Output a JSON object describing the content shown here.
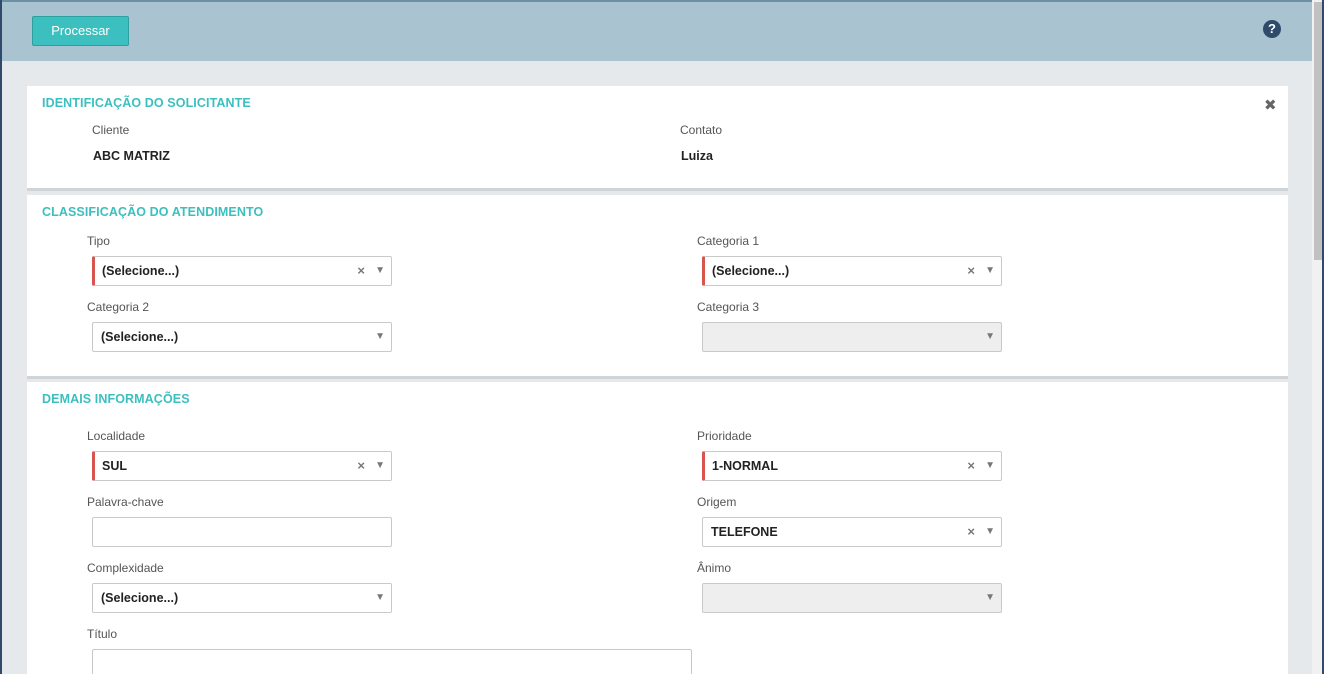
{
  "toolbar": {
    "processar_label": "Processar",
    "help_icon": "?"
  },
  "identificacao": {
    "title": "IDENTIFICAÇÃO DO SOLICITANTE",
    "close_icon": "✖",
    "cliente_label": "Cliente",
    "cliente_value": "ABC MATRIZ",
    "contato_label": "Contato",
    "contato_value": "Luiza"
  },
  "classificacao": {
    "title": "CLASSIFICAÇÃO DO ATENDIMENTO",
    "tipo_label": "Tipo",
    "tipo_value": "(Selecione...)",
    "categoria1_label": "Categoria 1",
    "categoria1_value": "(Selecione...)",
    "categoria2_label": "Categoria 2",
    "categoria2_value": "(Selecione...)",
    "categoria3_label": "Categoria 3",
    "categoria3_value": ""
  },
  "demais": {
    "title": "DEMAIS INFORMAÇÕES",
    "localidade_label": "Localidade",
    "localidade_value": "SUL",
    "prioridade_label": "Prioridade",
    "prioridade_value": "1-NORMAL",
    "palavra_label": "Palavra-chave",
    "palavra_value": "",
    "origem_label": "Origem",
    "origem_value": "TELEFONE",
    "complexidade_label": "Complexidade",
    "complexidade_value": "(Selecione...)",
    "animo_label": "Ânimo",
    "animo_value": "",
    "titulo_label": "Título",
    "titulo_value": ""
  },
  "glyphs": {
    "clear": "×",
    "caret": "▼"
  }
}
